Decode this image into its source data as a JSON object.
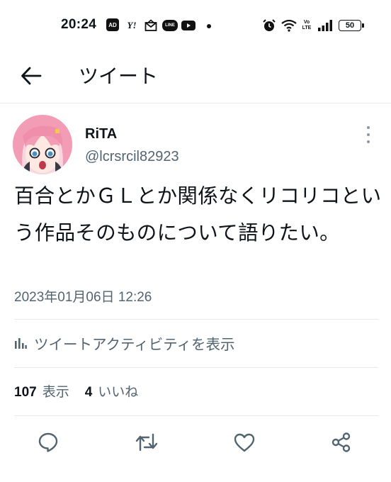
{
  "status_bar": {
    "time": "20:24",
    "ad_badge": "AD",
    "yahoo_badge": "Y!",
    "line_badge": "LINE",
    "volte_top": "Vo",
    "volte_bottom": "LTE",
    "battery": "50",
    "icons": [
      "ad-icon",
      "yahoo-icon",
      "mail-icon",
      "line-icon",
      "youtube-icon",
      "notification-dot-icon",
      "alarm-icon",
      "wifi-icon",
      "volte-icon",
      "signal-icon",
      "battery-icon"
    ]
  },
  "header": {
    "title": "ツイート",
    "back_icon": "arrow-left-icon"
  },
  "tweet": {
    "author_name": "RiTA",
    "author_handle": "@lcrsrcil82923",
    "text": "百合とかＧＬとか関係なくリコリコという作品そのものについて語りたい。",
    "timestamp": "2023年01月06日 12:26",
    "more_icon": "more-vertical-icon"
  },
  "activity": {
    "label": "ツイートアクティビティを表示",
    "icon": "analytics-icon"
  },
  "stats": {
    "views_count": "107",
    "views_label": "表示",
    "likes_count": "4",
    "likes_label": "いいね"
  },
  "actions": [
    "reply-icon",
    "retweet-icon",
    "like-icon",
    "share-icon"
  ],
  "colors": {
    "text_primary": "#0f1419",
    "text_secondary": "#536471",
    "divider": "#e6e9ec",
    "avatar_hair": "#f29cb6"
  }
}
